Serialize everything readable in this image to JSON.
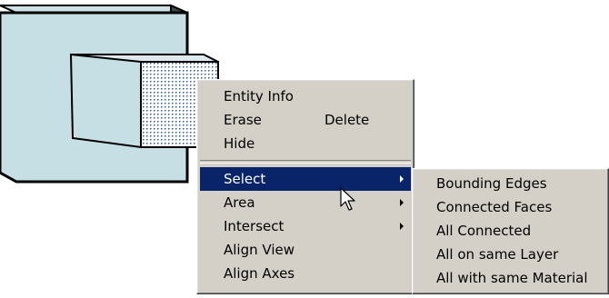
{
  "context_menu": {
    "items": [
      {
        "label": "Entity Info"
      },
      {
        "label": "Erase",
        "shortcut": "Delete"
      },
      {
        "label": "Hide"
      },
      {
        "label": "Select"
      },
      {
        "label": "Area"
      },
      {
        "label": "Intersect"
      },
      {
        "label": "Align View"
      },
      {
        "label": "Align Axes"
      }
    ]
  },
  "submenu": {
    "items": [
      {
        "label": "Bounding Edges"
      },
      {
        "label": "Connected Faces"
      },
      {
        "label": "All Connected"
      },
      {
        "label": "All on same Layer"
      },
      {
        "label": "All with same Material"
      }
    ]
  },
  "colors": {
    "menu_background": "#d4d0c8",
    "highlight": "#0a246a",
    "selection_face": "#d0dcf0",
    "model_face": "#c5dfe4"
  },
  "icons": {
    "cursor": "arrow-pointer-icon",
    "submenu_arrow": "chevron-right-icon"
  }
}
